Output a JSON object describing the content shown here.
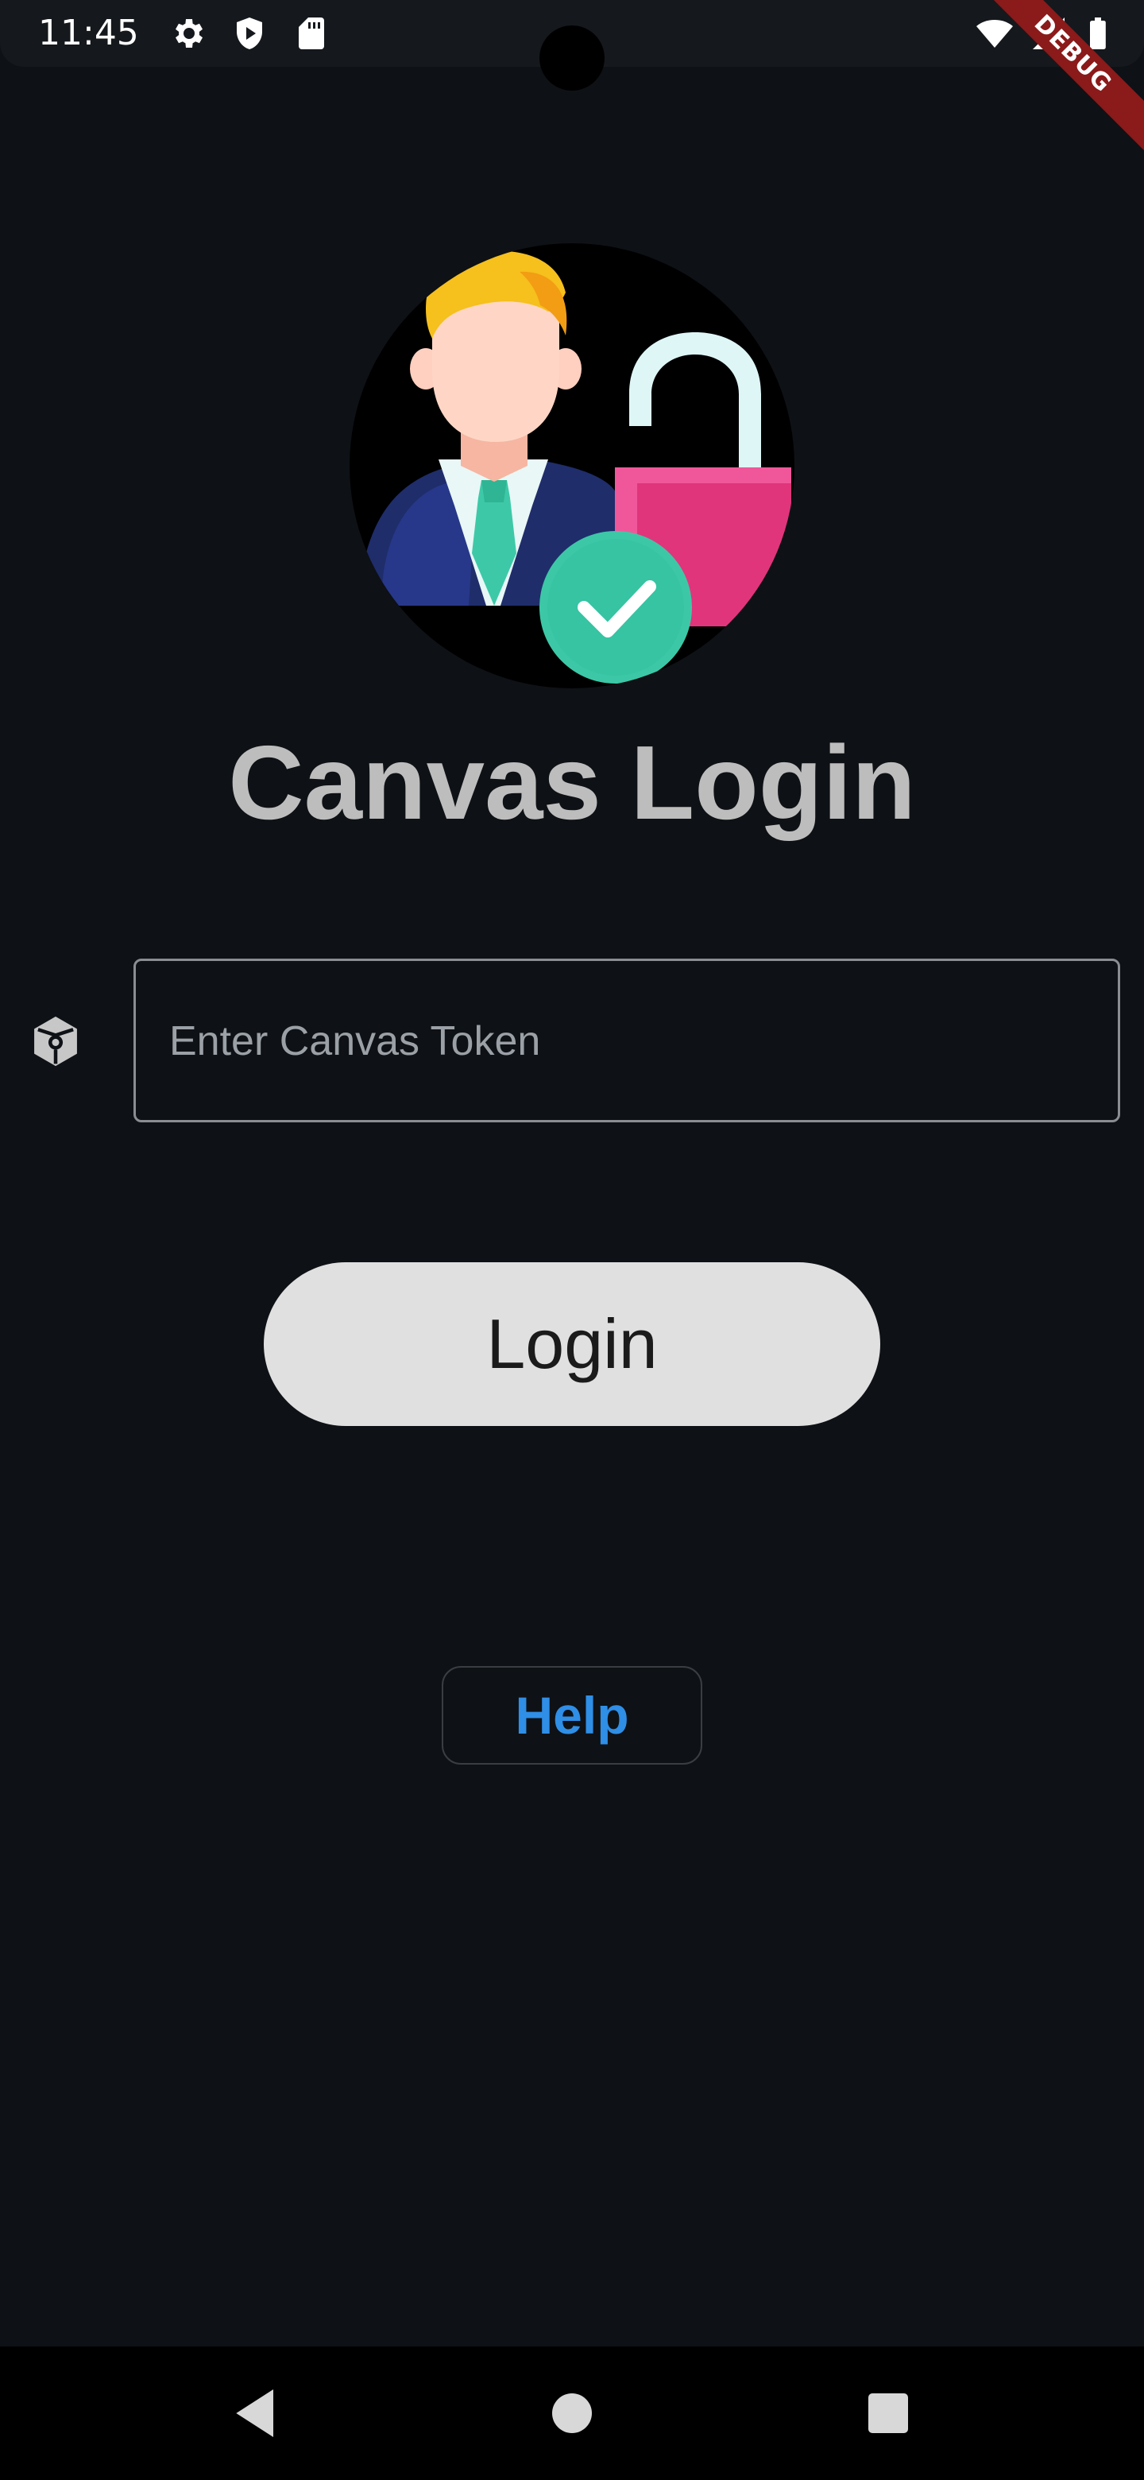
{
  "status_bar": {
    "time": "11:45",
    "icons": [
      "gear-icon",
      "shield-play-icon",
      "sd-card-icon",
      "wifi-icon",
      "signal-icon",
      "battery-icon"
    ],
    "debug_label": "DEBUG"
  },
  "hero": {
    "illustration": "user-unlock-illustration"
  },
  "page": {
    "title": "Canvas Login"
  },
  "token": {
    "icon": "cube-icon",
    "placeholder": "Enter Canvas Token",
    "value": ""
  },
  "actions": {
    "login_label": "Login",
    "help_label": "Help"
  },
  "nav_bar": {
    "back": "back-triangle-icon",
    "home": "home-circle-icon",
    "recents": "recents-square-icon"
  },
  "colors": {
    "background": "#0e1115",
    "title": "#bdbdbd",
    "login_button": "#e0e0e0",
    "help_text": "#2f8ee6",
    "field_border": "#8a8d91",
    "debug_ribbon": "#8b1a1a"
  }
}
